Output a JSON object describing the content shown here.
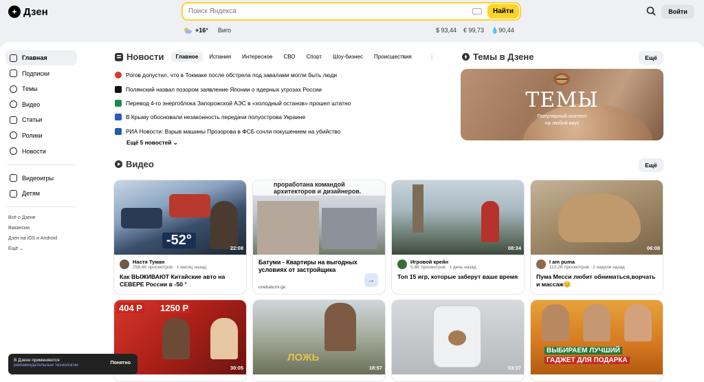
{
  "header": {
    "logo": "Дзен",
    "search_placeholder": "Поиск Яндекса",
    "search_button": "Найти",
    "login": "Войти"
  },
  "weather": {
    "temp": "+16°",
    "city": "Виго"
  },
  "rates": [
    "$ 93,44",
    "€ 99,73",
    "90,44"
  ],
  "sidebar": {
    "items": [
      {
        "label": "Главная",
        "icon": "home-icon"
      },
      {
        "label": "Подписки",
        "icon": "subscriptions-icon"
      },
      {
        "label": "Темы",
        "icon": "compass-icon"
      },
      {
        "label": "Видео",
        "icon": "video-icon"
      },
      {
        "label": "Статьи",
        "icon": "articles-icon"
      },
      {
        "label": "Ролики",
        "icon": "shorts-icon"
      },
      {
        "label": "Новости",
        "icon": "news-icon"
      },
      {
        "label": "Видеоигры",
        "icon": "gamepad-icon"
      },
      {
        "label": "Детям",
        "icon": "kids-icon"
      }
    ],
    "links": [
      "Всё о Дзене",
      "Вакансии",
      "Дзен на iOS и Android",
      "Ещё ⌄"
    ]
  },
  "news": {
    "title": "Новости",
    "tabs": [
      "Главное",
      "Испания",
      "Интересное",
      "СВО",
      "Спорт",
      "Шоу-бизнес",
      "Происшествия"
    ],
    "items": [
      {
        "text": "Рогов допустил, что в Токмаке после обстрела под завалами могли быть люди",
        "color": "#d93a2b"
      },
      {
        "text": "Полянский назвал позором заявление Японии о ядерных угрозах России",
        "color": "#111111"
      },
      {
        "text": "Перевод 4-го энергоблока Запорожской АЭС в «холодный останов» прошел штатно",
        "color": "#1d8a4d"
      },
      {
        "text": "В Крыму обосновали незаконность передачи полуострова Украине",
        "color": "#2a5cb8"
      },
      {
        "text": "РИА Новости: Взрыв машины Прозорова в ФСБ сочли покушением на убийство",
        "color": "#1f5fa8"
      }
    ],
    "more": "Ещё 5 новостей ⌄"
  },
  "themes": {
    "title": "Темы в Дзене",
    "more": "Ещё",
    "card_big": "ТЕМЫ",
    "card_sub1": "Популярный контент",
    "card_sub2": "на любой вкус"
  },
  "video": {
    "title": "Видео",
    "more": "Ещё",
    "cards": [
      {
        "channel": "Настя Туман",
        "sub": "258,4K просмотров · 1 месяц назад",
        "title": "Как ВЫЖИВАЮТ Китайские авто на СЕВЕРЕ России в -50 °",
        "duration": "22:08"
      },
      {
        "channel": "",
        "sub": "",
        "title": "Батуми - Квартиры на выгодных условиях от застройщика",
        "duration": "",
        "ad_domain": "onebatumi.ge"
      },
      {
        "channel": "Игровой крейн",
        "sub": "5,8K просмотров · 1 день назад",
        "title": "Топ 15 игр, которые заберут ваше время",
        "duration": "08:34"
      },
      {
        "channel": "I am puma",
        "sub": "113,2K просмотров · 2 недели назад",
        "title": "Пума Месси любит обниматься,ворчать и массаж😊",
        "duration": "06:08"
      },
      {
        "duration": "30:05"
      },
      {
        "duration": "18:57"
      },
      {
        "duration": "03:37"
      },
      {
        "duration": ""
      }
    ],
    "overlay_texts": {
      "ad_line1": "проработана командой",
      "ad_line2": "архитекторов и дизайнеров.",
      "thumb1_big": "-52°",
      "thumb5_p1": "404 Р",
      "thumb5_p2": "1250 Р",
      "thumb6_big": "ЛОЖЬ",
      "thumb8_l1": "ВЫБИРАЕМ ЛУЧШИЙ",
      "thumb8_l2": "ГАДЖЕТ ДЛЯ ПОДАРКА"
    }
  },
  "cookie": {
    "text": "В Дзене применяются",
    "link": "рекомендательные технологии",
    "ok": "Понятно"
  }
}
